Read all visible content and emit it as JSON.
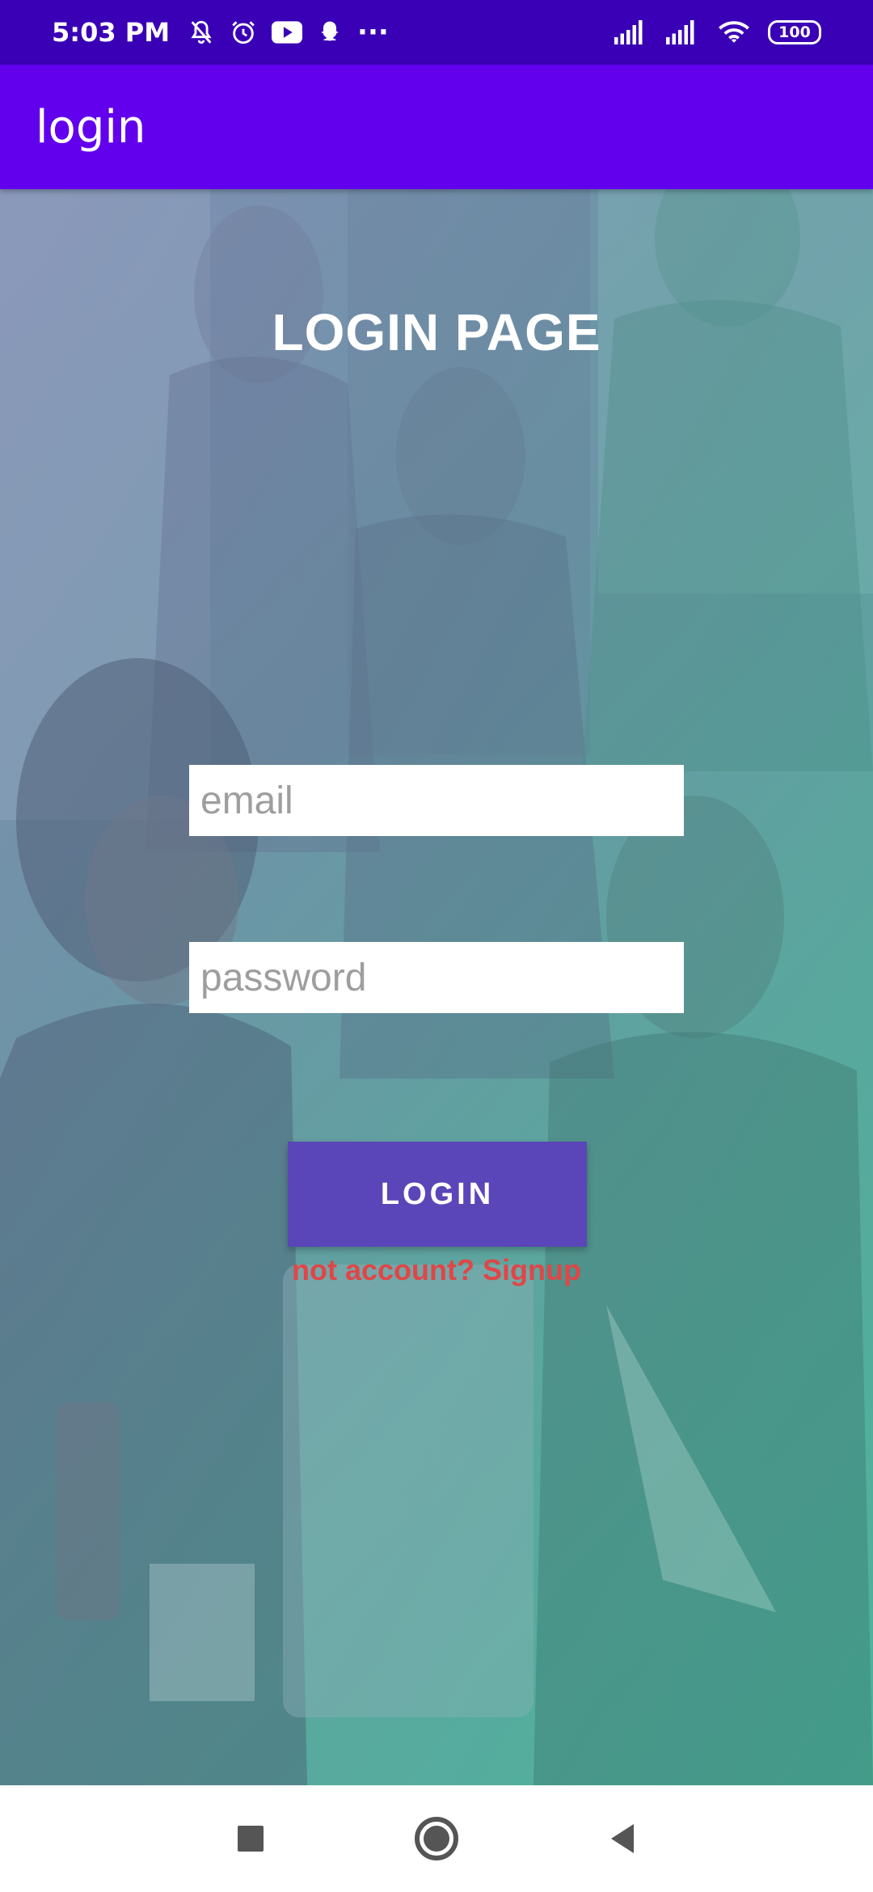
{
  "status_bar": {
    "time": "5:03 PM",
    "more": "···",
    "battery": "100",
    "icons_left": [
      "muted-bell-icon",
      "alarm-icon",
      "youtube-icon",
      "snapchat-icon",
      "more-dots-icon"
    ],
    "icons_right": [
      "signal-icon",
      "signal-icon",
      "wifi-icon",
      "battery-icon"
    ]
  },
  "app_bar": {
    "title": "login",
    "color": "#6200ee"
  },
  "login": {
    "heading": "LOGIN PAGE",
    "email_placeholder": "email",
    "password_placeholder": "password",
    "email_value": "",
    "password_value": "",
    "button_label": "LOGIN",
    "signup_text": "not account? Signup",
    "accent_color": "#5a46b8",
    "link_color": "#e04646"
  },
  "nav_bar": {
    "icons": [
      "recents-square-icon",
      "home-circle-icon",
      "back-triangle-icon"
    ]
  }
}
